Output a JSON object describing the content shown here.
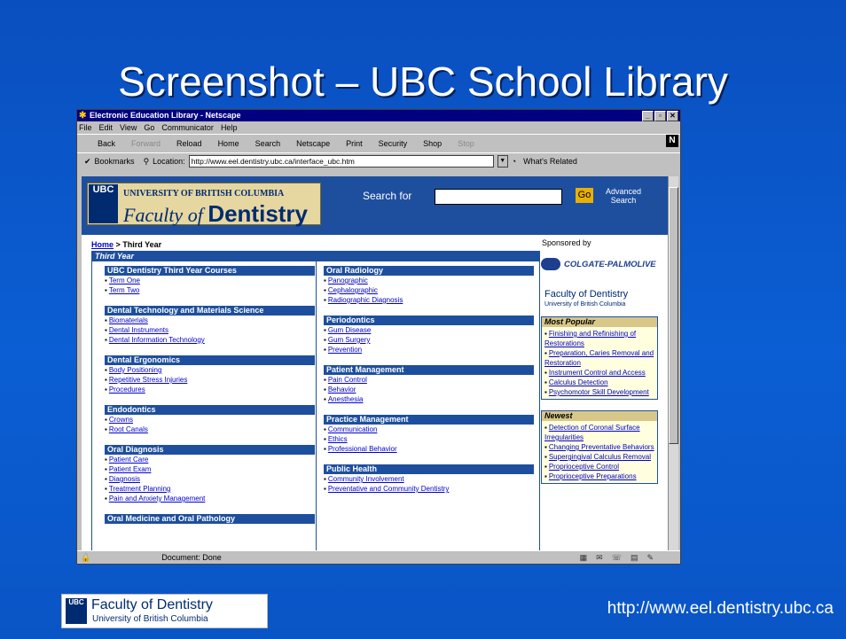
{
  "slide": {
    "title": "Screenshot – UBC School Library",
    "footer_url": "http://www.eel.dentistry.ubc.ca",
    "footer_logo": {
      "shield": "UBC",
      "name": "Faculty of Dentistry",
      "sub": "University of British Columbia"
    }
  },
  "browser": {
    "title": "Electronic Education Library - Netscape",
    "menus": [
      "File",
      "Edit",
      "View",
      "Go",
      "Communicator",
      "Help"
    ],
    "toolbar": [
      {
        "label": "Back",
        "enabled": true
      },
      {
        "label": "Forward",
        "enabled": false
      },
      {
        "label": "Reload",
        "enabled": true
      },
      {
        "label": "Home",
        "enabled": true
      },
      {
        "label": "Search",
        "enabled": true
      },
      {
        "label": "Netscape",
        "enabled": true
      },
      {
        "label": "Print",
        "enabled": true
      },
      {
        "label": "Security",
        "enabled": true
      },
      {
        "label": "Shop",
        "enabled": true
      },
      {
        "label": "Stop",
        "enabled": false
      }
    ],
    "netscape_badge": "N",
    "bookmarks_label": "Bookmarks",
    "location_label": "Location:",
    "url": "http://www.eel.dentistry.ubc.ca/interface_ubc.htm",
    "whats_related": "What's Related",
    "status_text": "Document: Done"
  },
  "page": {
    "logo": {
      "shield": "UBC",
      "university": "UNIVERSITY OF BRITISH COLUMBIA",
      "faculty_of": "Faculty of",
      "dentistry": "Dentistry"
    },
    "search_label": "Search for",
    "go_label": "Go",
    "advanced_search": "Advanced Search",
    "breadcrumb": {
      "home": "Home",
      "current": " > Third Year"
    },
    "sponsored_by": "Sponsored by",
    "main_heading": "Third Year",
    "left_sections": [
      {
        "title": "UBC Dentistry Third Year Courses",
        "links": [
          "Term One",
          "Term Two"
        ]
      },
      {
        "title": "Dental Technology and Materials Science",
        "links": [
          "Biomaterials",
          "Dental Instruments",
          "Dental Information Technology"
        ]
      },
      {
        "title": "Dental Ergonomics",
        "links": [
          "Body Positioning",
          "Repetitive Stress Injuries",
          "Procedures"
        ]
      },
      {
        "title": "Endodontics",
        "links": [
          "Crowns",
          "Root Canals"
        ]
      },
      {
        "title": "Oral Diagnosis",
        "links": [
          "Patient Care",
          "Patient Exam",
          "Diagnosis",
          "Treatment Planning",
          "Pain and Anxiety Management"
        ]
      },
      {
        "title": "Oral Medicine and Oral Pathology",
        "links": []
      }
    ],
    "right_sections": [
      {
        "title": "Oral Radiology",
        "links": [
          "Panographic",
          "Cephalographic",
          "Radiographic Diagnosis"
        ]
      },
      {
        "title": "Periodontics",
        "links": [
          "Gum Disease",
          "Gum Surgery",
          "Prevention"
        ]
      },
      {
        "title": "Patient Management",
        "links": [
          "Pain Control",
          "Behavior",
          "Anesthesia"
        ]
      },
      {
        "title": "Practice Management",
        "links": [
          "Communication",
          "Ethics",
          "Professional Behavior"
        ]
      },
      {
        "title": "Public Health",
        "links": [
          "Community Involvement",
          "Preventative and Community Dentistry"
        ]
      }
    ],
    "sponsor": "COLGATE-PALMOLIVE",
    "fod_small": {
      "name": "Faculty of Dentistry",
      "sub": "University of British Columbia"
    },
    "most_popular": {
      "title": "Most Popular",
      "links": [
        "Finishing and Refinishing of Restorations",
        "Preparation, Caries Removal and Restoration",
        "Instrument Control and Access",
        "Calculus Detection",
        "Psychomotor Skill Development"
      ]
    },
    "newest": {
      "title": "Newest",
      "links": [
        "Detection of Coronal Surface Irregularities",
        "Changing Preventative Behaviors",
        "Supergingival Calculus Removal",
        "Proprioceptive Control",
        "Proprioceptive Preparations"
      ]
    }
  }
}
